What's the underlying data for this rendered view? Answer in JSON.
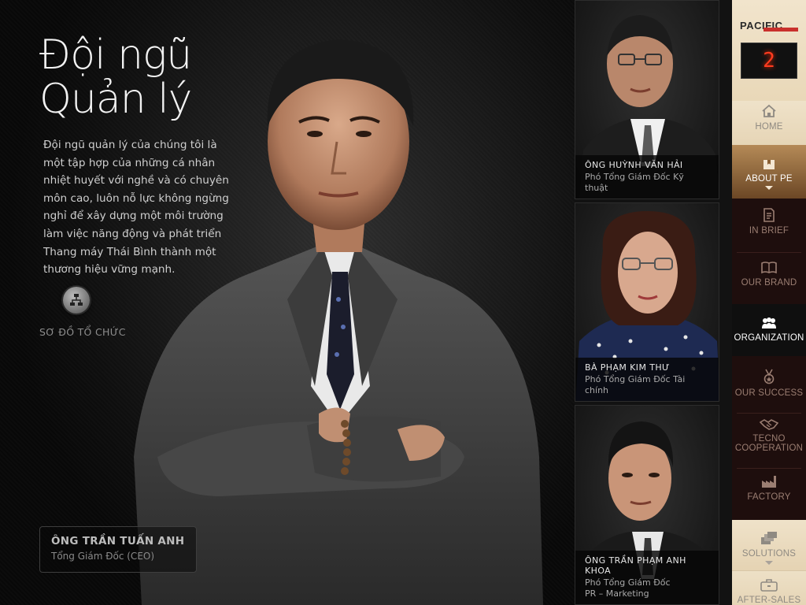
{
  "hero": {
    "title_line1": "Đội ngũ",
    "title_line2": "Quản lý",
    "intro": "Đội ngũ quản lý của chúng tôi là một tập hợp của những cá nhân nhiệt huyết với nghề và có chuyên môn cao, luôn nỗ lực không ngừng nghỉ để xây dựng một môi trường làm việc năng động và phát triển Thang máy Thái Bình thành một thương hiệu vững mạnh.",
    "org_chart_label": "SƠ ĐỒ TỔ CHỨC",
    "ceo": {
      "name": "ÔNG TRẦN TUẤN ANH",
      "role": "Tổng Giám Đốc (CEO)"
    }
  },
  "team": [
    {
      "name": "ÔNG HUỲNH VĂN HẢI",
      "role": "Phó Tổng Giám Đốc Kỹ thuật",
      "role2": ""
    },
    {
      "name": "BÀ PHẠM KIM THƯ",
      "role": "Phó Tổng Giám Đốc Tài chính",
      "role2": ""
    },
    {
      "name": "ÔNG TRẦN PHẠM ANH KHOA",
      "role": "Phó Tổng Giám Đốc",
      "role2": "PR – Marketing"
    }
  ],
  "nav": {
    "logo": "PACIFIC",
    "floor": "2",
    "home": "HOME",
    "about": "ABOUT PE",
    "inbrief": "IN BRIEF",
    "ourbrand": "OUR BRAND",
    "organization": "ORGANIZATION",
    "oursuccess": "OUR SUCCESS",
    "tecno_line1": "TECNO",
    "tecno_line2": "COOPERATION",
    "factory": "FACTORY",
    "solutions": "SOLUTIONS",
    "aftersales": "AFTER-SALES"
  },
  "colors": {
    "nav_bg": "#1e0e0d",
    "nav_active": "#b58a57",
    "floor_digit": "#ff3b1f"
  }
}
